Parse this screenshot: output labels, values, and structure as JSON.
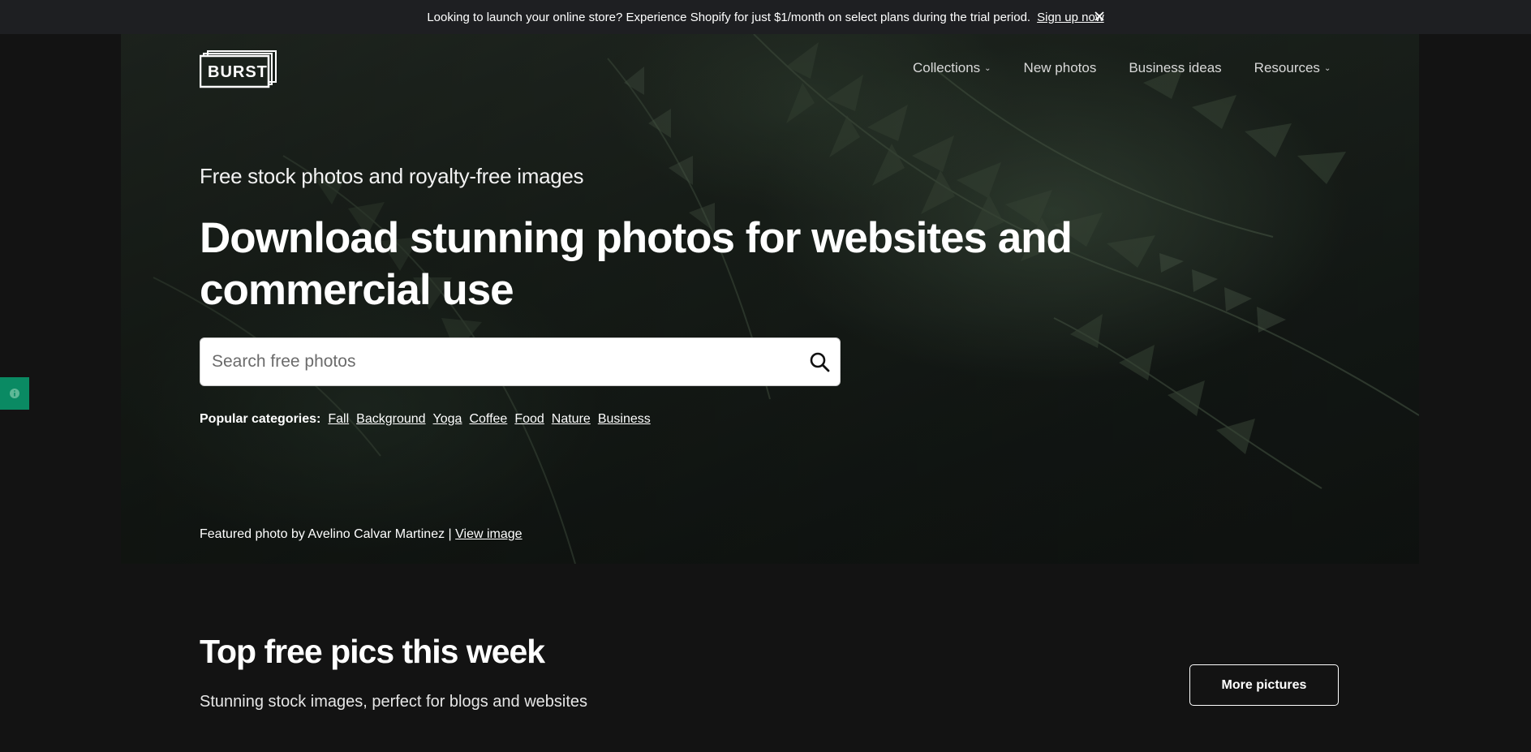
{
  "announcement": {
    "message": "Looking to launch your online store? Experience Shopify for just $1/month on select plans during the trial period.",
    "link": "Sign up now",
    "close_icon": "close-icon"
  },
  "brand": {
    "logo_text": "BURST"
  },
  "nav": {
    "items": [
      {
        "label": "Collections",
        "dropdown": true
      },
      {
        "label": "New photos",
        "dropdown": false
      },
      {
        "label": "Business ideas",
        "dropdown": false
      },
      {
        "label": "Resources",
        "dropdown": true
      }
    ]
  },
  "hero": {
    "tagline": "Free stock photos and royalty-free images",
    "headline": "Download stunning photos for websites and commercial use",
    "search": {
      "placeholder": "Search free photos",
      "value": "",
      "icon": "search-icon"
    },
    "popular_label": "Popular categories:",
    "categories": [
      "Fall",
      "Background",
      "Yoga",
      "Coffee",
      "Food",
      "Nature",
      "Business"
    ],
    "featured_text": "Featured photo by Avelino Calvar Martinez |",
    "featured_link": "View image"
  },
  "side_widget": {
    "icon": "info-icon",
    "color": "#0a8a63"
  },
  "section": {
    "title": "Top free pics this week",
    "subtitle": "Stunning stock images, perfect for blogs and websites",
    "more_button": "More pictures"
  },
  "colors": {
    "page_bg": "#131313",
    "announcement_bg": "#1e1f22",
    "accent_green": "#0a8a63"
  }
}
